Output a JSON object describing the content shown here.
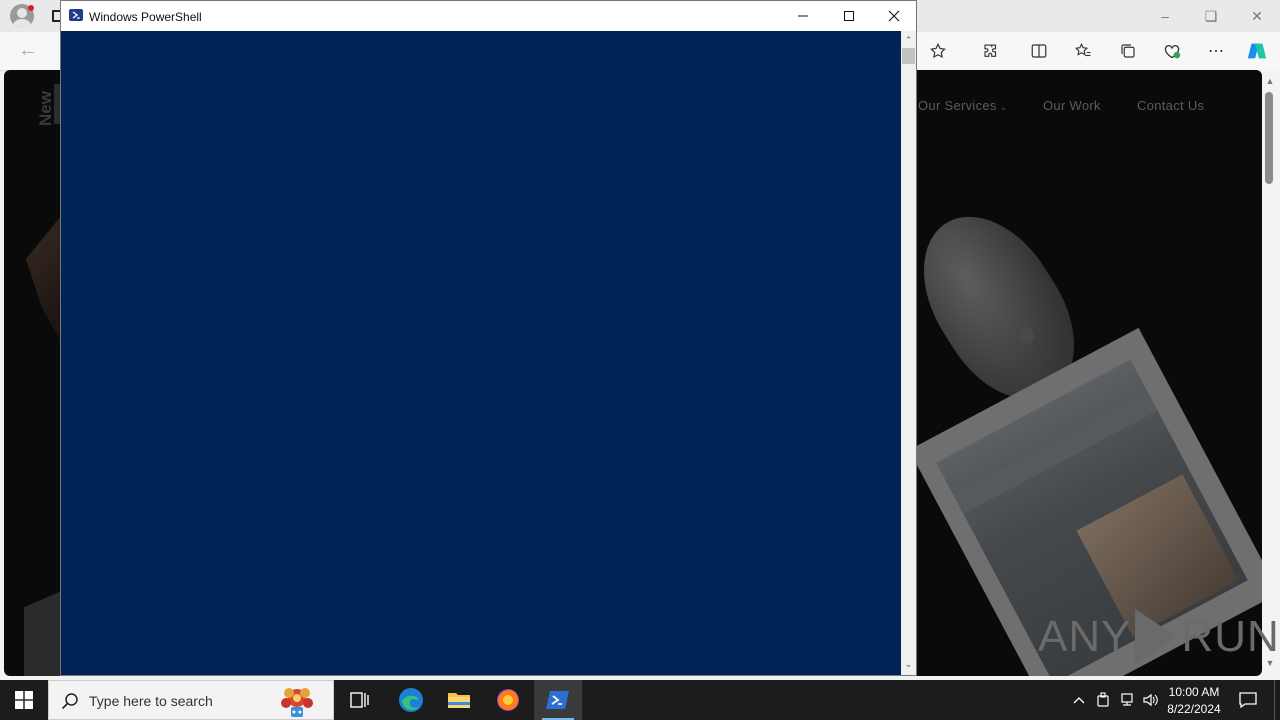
{
  "powershell": {
    "title": "Windows PowerShell"
  },
  "browser": {
    "nav": {
      "services": "Our Services",
      "work": "Our Work",
      "contact": "Contact Us"
    },
    "brand_text": "New"
  },
  "watermark": {
    "left": "ANY",
    "right": "RUN"
  },
  "taskbar": {
    "search_placeholder": "Type here to search",
    "time": "10:00 AM",
    "date": "8/22/2024"
  },
  "colors": {
    "console_bg": "#012456",
    "taskbar_bg": "#1c1c1c",
    "active_indicator": "#76b9ed"
  }
}
